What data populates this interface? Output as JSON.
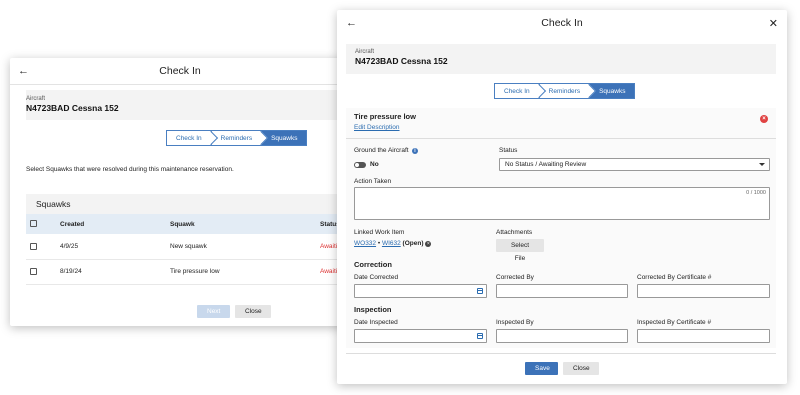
{
  "back_dialog": {
    "title": "Check In",
    "aircraft_label": "Aircraft",
    "aircraft_name": "N4723BAD Cessna 152",
    "steps": [
      "Check In",
      "Reminders",
      "Squawks"
    ],
    "instructions": "Select Squawks that were resolved during this maintenance reservation.",
    "squawks_heading": "Squawks",
    "columns": [
      "Created",
      "Squawk",
      "Status"
    ],
    "rows": [
      {
        "created": "4/9/25",
        "squawk": "New squawk",
        "status": "Awaitin"
      },
      {
        "created": "8/19/24",
        "squawk": "Tire pressure low",
        "status": "Awaitin"
      }
    ],
    "next_label": "Next",
    "close_label": "Close"
  },
  "front_dialog": {
    "title": "Check In",
    "aircraft_label": "Aircraft",
    "aircraft_name": "N4723BAD Cessna 152",
    "steps": [
      "Check In",
      "Reminders",
      "Squawks"
    ],
    "squawk_title": "Tire pressure low",
    "edit_description": "Edit Description",
    "ground_label": "Ground the Aircraft",
    "ground_value": "No",
    "status_label": "Status",
    "status_value": "No Status / Awaiting Review",
    "action_taken_label": "Action Taken",
    "action_counter": "0 / 1000",
    "linked_label": "Linked Work Item",
    "linked_wo": "WO332",
    "linked_sep": " • ",
    "linked_wi": "WI632",
    "linked_status": "(Open)",
    "attachments_label": "Attachments",
    "select_file": "Select File",
    "correction_heading": "Correction",
    "date_corrected": "Date Corrected",
    "corrected_by": "Corrected By",
    "corrected_cert": "Corrected By Certificate #",
    "inspection_heading": "Inspection",
    "date_inspected": "Date Inspected",
    "inspected_by": "Inspected By",
    "inspected_cert": "Inspected By Certificate #",
    "save_label": "Save",
    "close_label": "Close"
  },
  "colors": {
    "accent": "#3c72b8",
    "danger": "#e04343",
    "status_red": "#dd3333"
  },
  "icons": [
    "back-arrow-icon",
    "close-icon",
    "info-icon",
    "calendar-icon",
    "remove-icon",
    "clear-icon"
  ]
}
